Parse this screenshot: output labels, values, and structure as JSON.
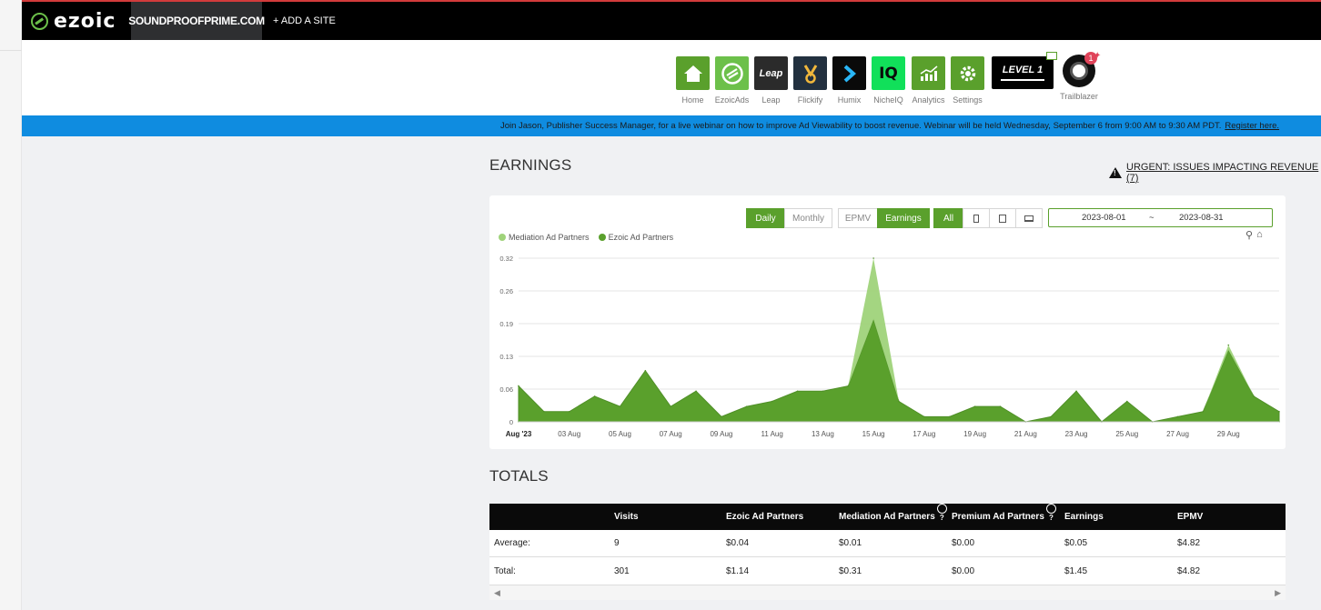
{
  "topbar": {
    "logo_text": "ezoic",
    "site_name": "SOUNDPROOFPRIME.COM",
    "add_site": "+ ADD A SITE"
  },
  "apps": [
    {
      "label": "Home",
      "icon": "house-icon"
    },
    {
      "label": "EzoicAds",
      "icon": "ezoic-ads-icon"
    },
    {
      "label": "Leap",
      "icon": "leap-icon",
      "tile_text": "Leap"
    },
    {
      "label": "Flickify",
      "icon": "flickify-icon"
    },
    {
      "label": "Humix",
      "icon": "humix-icon"
    },
    {
      "label": "NicheIQ",
      "icon": "nicheiq-icon",
      "tile_text": "IQ"
    },
    {
      "label": "Analytics",
      "icon": "analytics-icon"
    },
    {
      "label": "Settings",
      "icon": "gear-icon"
    }
  ],
  "level_badge": "LEVEL 1",
  "trailblazer": {
    "label": "Trailblazer",
    "notification_count": "1"
  },
  "banner": {
    "text": "Join Jason, Publisher Success Manager, for a live webinar on how to improve Ad Viewability to boost revenue. Webinar will be held Wednesday, September 6 from 9:00 AM to 9:30 AM PDT.",
    "link": "Register here."
  },
  "earnings": {
    "title": "EARNINGS",
    "urgent": "URGENT: ISSUES IMPACTING REVENUE (7)",
    "period_buttons": [
      "Daily",
      "Monthly"
    ],
    "metric_buttons": [
      "EPMV",
      "Earnings"
    ],
    "device_all": "All",
    "date_start": "2023-08-01",
    "date_sep": "~",
    "date_end": "2023-08-31"
  },
  "colors": {
    "accent": "#5aa02c",
    "ezoic_series": "#5aa02c",
    "mediation_series": "#9fd37a",
    "banner": "#0f8ce0",
    "topbar": "#000000"
  },
  "chart_data": {
    "type": "area",
    "title": "",
    "xlabel": "",
    "ylabel": "",
    "ylim": [
      0,
      0.32
    ],
    "y_ticks": [
      "0",
      "0.06",
      "0.13",
      "0.19",
      "0.26",
      "0.32"
    ],
    "x_tick_labels": [
      "Aug '23",
      "03 Aug",
      "05 Aug",
      "07 Aug",
      "09 Aug",
      "11 Aug",
      "13 Aug",
      "15 Aug",
      "17 Aug",
      "19 Aug",
      "21 Aug",
      "23 Aug",
      "25 Aug",
      "27 Aug",
      "29 Aug"
    ],
    "x": [
      1,
      2,
      3,
      4,
      5,
      6,
      7,
      8,
      9,
      10,
      11,
      12,
      13,
      14,
      15,
      16,
      17,
      18,
      19,
      20,
      21,
      22,
      23,
      24,
      25,
      26,
      27,
      28,
      29,
      30,
      31
    ],
    "legend_position": "top-left",
    "grid": true,
    "series": [
      {
        "name": "Ezoic Ad Partners",
        "values": [
          0.07,
          0.02,
          0.02,
          0.05,
          0.03,
          0.1,
          0.03,
          0.06,
          0.01,
          0.03,
          0.04,
          0.06,
          0.06,
          0.07,
          0.2,
          0.04,
          0.01,
          0.01,
          0.03,
          0.03,
          0.0,
          0.01,
          0.06,
          0.0,
          0.04,
          0.0,
          0.01,
          0.02,
          0.14,
          0.05,
          0.02
        ]
      },
      {
        "name": "Mediation Ad Partners",
        "values": [
          0,
          0,
          0,
          0,
          0,
          0,
          0,
          0,
          0,
          0,
          0,
          0,
          0,
          0,
          0.12,
          0,
          0,
          0,
          0,
          0,
          0,
          0,
          0,
          0,
          0,
          0,
          0,
          0,
          0.01,
          0,
          0
        ]
      }
    ]
  },
  "totals": {
    "title": "TOTALS",
    "columns": [
      "",
      "Visits",
      "Ezoic Ad Partners",
      "Mediation Ad Partners",
      "Premium Ad Partners",
      "Earnings",
      "EPMV"
    ],
    "rows": [
      [
        "Average:",
        "9",
        "$0.04",
        "$0.01",
        "$0.00",
        "$0.05",
        "$4.82"
      ],
      [
        "Total:",
        "301",
        "$1.14",
        "$0.31",
        "$0.00",
        "$1.45",
        "$4.82"
      ]
    ]
  }
}
